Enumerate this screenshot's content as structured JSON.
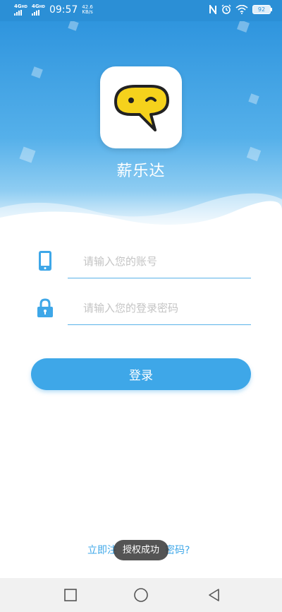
{
  "status_bar": {
    "network1": "4G",
    "network1_sup": "HD",
    "network2": "4G",
    "network2_sup": "HD",
    "time": "09:57",
    "speed_value": "42.6",
    "speed_unit": "KB/s",
    "battery": "92"
  },
  "header": {
    "app_name": "薪乐达"
  },
  "form": {
    "account_placeholder": "请输入您的账号",
    "password_placeholder": "请输入您的登录密码",
    "login_label": "登录"
  },
  "footer": {
    "register_link_left": "立即注",
    "register_link_right": "密码?"
  },
  "toast": {
    "message": "授权成功"
  },
  "colors": {
    "brand_blue": "#3ea7e8",
    "status_bar": "#2b8fd6",
    "logo_yellow": "#f5d21c"
  }
}
